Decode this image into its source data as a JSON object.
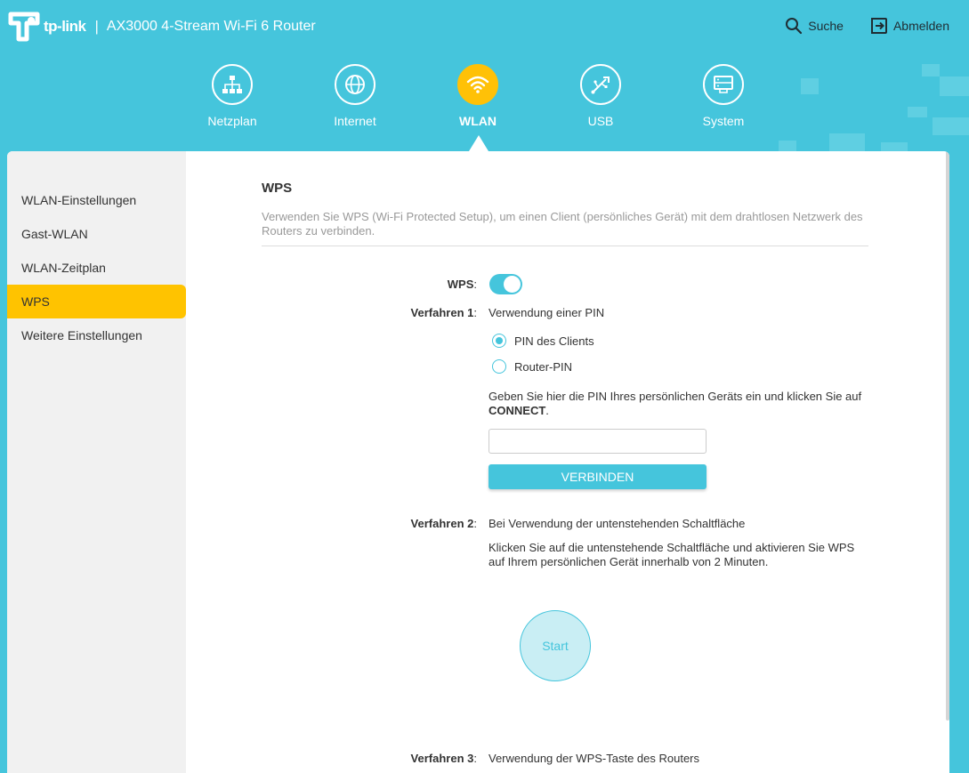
{
  "header": {
    "brand": "tp-link",
    "separator": "|",
    "model": "AX3000 4-Stream Wi-Fi 6 Router",
    "search_label": "Suche",
    "logout_label": "Abmelden"
  },
  "nav": {
    "items": [
      {
        "label": "Netzplan",
        "icon": "network-map-icon"
      },
      {
        "label": "Internet",
        "icon": "globe-icon"
      },
      {
        "label": "WLAN",
        "icon": "wifi-icon",
        "active": true
      },
      {
        "label": "USB",
        "icon": "usb-icon"
      },
      {
        "label": "System",
        "icon": "system-icon"
      }
    ]
  },
  "sidebar": {
    "items": [
      {
        "label": "WLAN-Einstellungen"
      },
      {
        "label": "Gast-WLAN"
      },
      {
        "label": "WLAN-Zeitplan"
      },
      {
        "label": "WPS",
        "active": true
      },
      {
        "label": "Weitere Einstellungen"
      }
    ]
  },
  "main": {
    "title": "WPS",
    "description": "Verwenden Sie WPS (Wi-Fi Protected Setup), um einen Client (persönliches Gerät) mit dem drahtlosen Netzwerk des Routers zu verbinden.",
    "wps_label": "WPS",
    "wps_enabled": true,
    "method1": {
      "label": "Verfahren 1",
      "value": "Verwendung einer PIN",
      "option_client_pin": "PIN des Clients",
      "option_router_pin": "Router-PIN",
      "selected": "PIN des Clients",
      "hint_text": "Geben Sie hier die PIN Ihres persönlichen Geräts ein und klicken Sie auf ",
      "hint_bold": "CONNECT",
      "hint_end": ".",
      "pin_value": "",
      "connect_label": "VERBINDEN"
    },
    "method2": {
      "label": "Verfahren 2",
      "value": "Bei Verwendung der untenstehenden Schaltfläche",
      "hint": "Klicken Sie auf die untenstehende Schaltfläche und aktivieren Sie WPS auf Ihrem persönlichen Gerät innerhalb von 2 Minuten.",
      "start_label": "Start"
    },
    "method3": {
      "label": "Verfahren 3",
      "value": "Verwendung der WPS-Taste des Routers"
    },
    "colon": ":"
  },
  "colors": {
    "accent": "#45c5dc",
    "active_nav": "#ffc107",
    "active_sidebar": "#ffc300",
    "sidebar_bg": "#f1f1f1"
  }
}
